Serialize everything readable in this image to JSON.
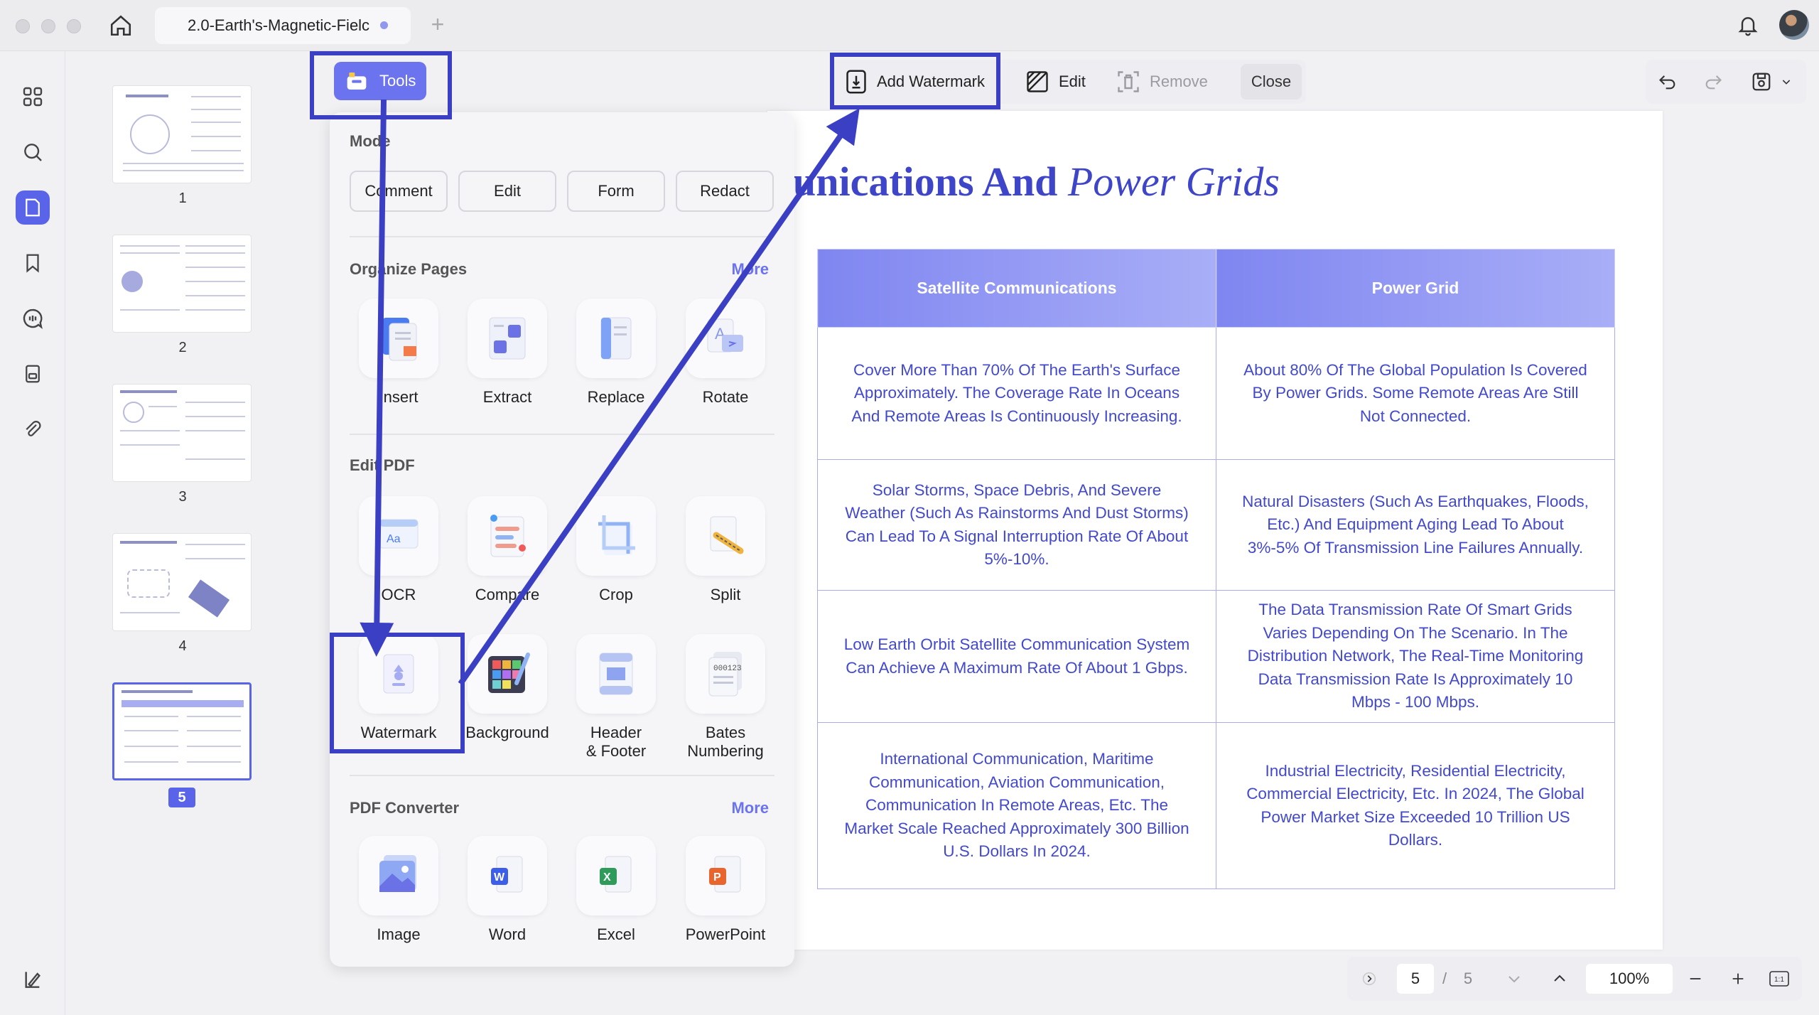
{
  "titlebar": {
    "tab_title": "2.0-Earth's-Magnetic-Fielc",
    "new_tab": "+"
  },
  "thumbnails": {
    "pages": [
      "1",
      "2",
      "3",
      "4",
      "5"
    ],
    "selected": "5"
  },
  "toolbar": {
    "tools_label": "Tools",
    "add_watermark_label": "Add Watermark",
    "edit_label": "Edit",
    "remove_label": "Remove",
    "close_label": "Close"
  },
  "tools_panel": {
    "mode_title": "Mode",
    "mode_buttons": [
      "Comment",
      "Edit",
      "Form",
      "Redact"
    ],
    "organize_title": "Organize Pages",
    "organize_more": "More",
    "organize_tools": [
      "Insert",
      "Extract",
      "Replace",
      "Rotate"
    ],
    "edit_title": "Edit PDF",
    "edit_tools_row1": [
      "OCR",
      "Compare",
      "Crop",
      "Split"
    ],
    "edit_tools_row2": [
      "Watermark",
      "Background",
      "Header\n& Footer",
      "Bates\nNumbering"
    ],
    "converter_title": "PDF Converter",
    "converter_more": "More",
    "converter_tools": [
      "Image",
      "Word",
      "Excel",
      "PowerPoint"
    ]
  },
  "document": {
    "title_bold": "unications And ",
    "title_italic": "Power Grids",
    "table": {
      "headers": [
        "Satellite Communications",
        "Power Grid"
      ],
      "rows": [
        [
          "Cover More Than 70% Of The Earth's Surface Approximately. The Coverage Rate In Oceans And Remote Areas Is Continuously Increasing.",
          "About 80% Of The Global Population Is Covered By Power Grids. Some Remote Areas Are Still Not Connected."
        ],
        [
          "Solar Storms, Space Debris, And Severe Weather (Such As Rainstorms And Dust Storms) Can Lead To A Signal Interruption Rate Of About 5%-10%.",
          "Natural Disasters (Such As Earthquakes, Floods, Etc.) And Equipment Aging Lead To About 3%-5% Of Transmission Line Failures Annually."
        ],
        [
          "Low Earth Orbit Satellite Communication System Can Achieve A Maximum Rate Of About 1 Gbps.",
          "The Data Transmission Rate Of Smart Grids Varies Depending On The Scenario. In The Distribution Network, The Real-Time Monitoring Data Transmission Rate Is Approximately 10 Mbps - 100 Mbps."
        ],
        [
          "International Communication, Maritime Communication, Aviation Communication, Communication In Remote Areas, Etc. The Market Scale Reached Approximately 300 Billion U.S. Dollars In 2024.",
          "Industrial Electricity, Residential Electricity, Commercial Electricity, Etc. In 2024, The Global Power Market Size Exceeded 10 Trillion US Dollars."
        ]
      ]
    }
  },
  "bottom_nav": {
    "current_page": "5",
    "separator": "/",
    "total_pages": "5",
    "zoom": "100%"
  },
  "colors": {
    "accent": "#5a64e8",
    "annotation": "#3b3fc4",
    "table_text": "#4249cc"
  }
}
